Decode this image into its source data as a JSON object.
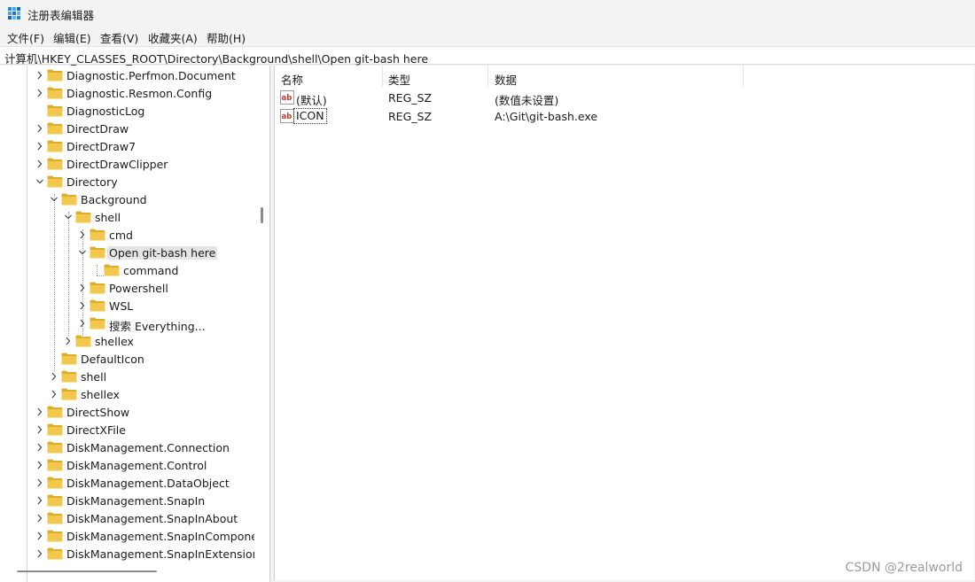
{
  "window": {
    "title": "注册表编辑器"
  },
  "menu": [
    "文件(F)",
    "编辑(E)",
    "查看(V)",
    "收藏夹(A)",
    "帮助(H)"
  ],
  "address": "计算机\\HKEY_CLASSES_ROOT\\Directory\\Background\\shell\\Open git-bash here",
  "tree": [
    {
      "label": "Diagnostic.Perfmon.Document",
      "level": 0,
      "expander": "collapsed"
    },
    {
      "label": "Diagnostic.Resmon.Config",
      "level": 0,
      "expander": "collapsed"
    },
    {
      "label": "DiagnosticLog",
      "level": 0,
      "expander": "none"
    },
    {
      "label": "DirectDraw",
      "level": 0,
      "expander": "collapsed"
    },
    {
      "label": "DirectDraw7",
      "level": 0,
      "expander": "collapsed"
    },
    {
      "label": "DirectDrawClipper",
      "level": 0,
      "expander": "collapsed"
    },
    {
      "label": "Directory",
      "level": 0,
      "expander": "expanded"
    },
    {
      "label": "Background",
      "level": 1,
      "expander": "expanded"
    },
    {
      "label": "shell",
      "level": 2,
      "expander": "expanded"
    },
    {
      "label": "cmd",
      "level": 3,
      "expander": "collapsed"
    },
    {
      "label": "Open git-bash here",
      "level": 3,
      "expander": "expanded",
      "selected": true
    },
    {
      "label": "command",
      "level": 4,
      "expander": "none"
    },
    {
      "label": "Powershell",
      "level": 3,
      "expander": "collapsed"
    },
    {
      "label": "WSL",
      "level": 3,
      "expander": "collapsed"
    },
    {
      "label": "搜索 Everything...",
      "level": 3,
      "expander": "collapsed"
    },
    {
      "label": "shellex",
      "level": 2,
      "expander": "collapsed"
    },
    {
      "label": "DefaultIcon",
      "level": 1,
      "expander": "none"
    },
    {
      "label": "shell",
      "level": 1,
      "expander": "collapsed"
    },
    {
      "label": "shellex",
      "level": 1,
      "expander": "collapsed"
    },
    {
      "label": "DirectShow",
      "level": 0,
      "expander": "collapsed"
    },
    {
      "label": "DirectXFile",
      "level": 0,
      "expander": "collapsed"
    },
    {
      "label": "DiskManagement.Connection",
      "level": 0,
      "expander": "collapsed"
    },
    {
      "label": "DiskManagement.Control",
      "level": 0,
      "expander": "collapsed"
    },
    {
      "label": "DiskManagement.DataObject",
      "level": 0,
      "expander": "collapsed"
    },
    {
      "label": "DiskManagement.SnapIn",
      "level": 0,
      "expander": "collapsed"
    },
    {
      "label": "DiskManagement.SnapInAbout",
      "level": 0,
      "expander": "collapsed"
    },
    {
      "label": "DiskManagement.SnapInComponent",
      "level": 0,
      "expander": "collapsed"
    },
    {
      "label": "DiskManagement.SnapInExtension",
      "level": 0,
      "expander": "collapsed"
    }
  ],
  "list": {
    "columns": [
      "名称",
      "类型",
      "数据"
    ],
    "rows": [
      {
        "name": "(默认)",
        "type": "REG_SZ",
        "data": "(数值未设置)",
        "icon": "string-value-icon"
      },
      {
        "name": "ICON",
        "type": "REG_SZ",
        "data": "A:\\Git\\git-bash.exe",
        "icon": "string-value-icon",
        "focused": true
      }
    ]
  },
  "watermark": "CSDN @2realworld",
  "colors": {
    "folder": "#f2c94c",
    "folder_dark": "#e0ac2b",
    "selection": "#e5e5e5",
    "value_icon_red": "#c0392b"
  }
}
